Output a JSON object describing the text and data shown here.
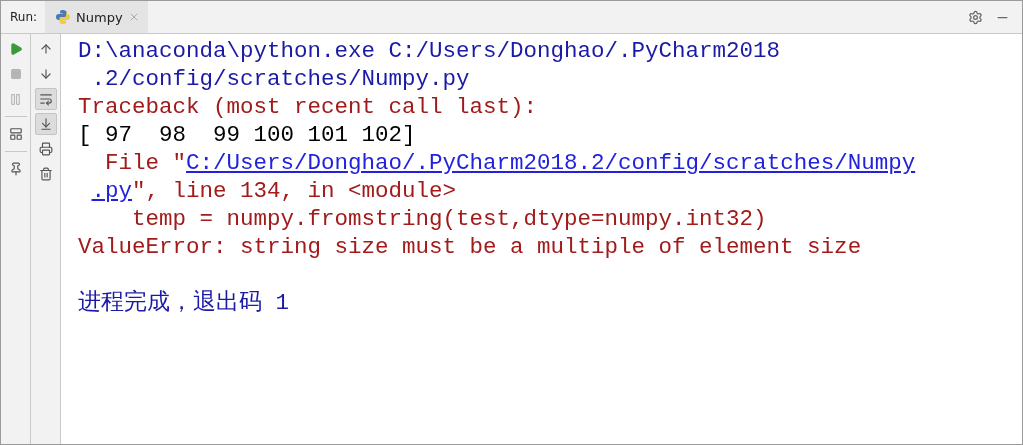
{
  "header": {
    "label": "Run:",
    "tabs": [
      {
        "label": "Numpy",
        "selected": true
      }
    ]
  },
  "left_toolbar": [
    {
      "kind": "run"
    },
    {
      "kind": "stop",
      "disabled": true
    },
    {
      "kind": "pause",
      "disabled": true
    },
    {
      "kind": "sep"
    },
    {
      "kind": "layout"
    },
    {
      "kind": "sep"
    },
    {
      "kind": "pin"
    }
  ],
  "right_toolbar": [
    {
      "kind": "up",
      "selected": false
    },
    {
      "kind": "down",
      "selected": false
    },
    {
      "kind": "wrap",
      "selected": true
    },
    {
      "kind": "scroll",
      "selected": true
    },
    {
      "kind": "print",
      "selected": false
    },
    {
      "kind": "trash",
      "selected": false
    }
  ],
  "console": {
    "lines": [
      [
        {
          "kind": "cmd",
          "text": "D:\\anaconda\\python.exe C:/Users/Donghao/.PyCharm2018"
        }
      ],
      [
        {
          "kind": "cmd",
          "text": " .2/config/scratches/Numpy.py"
        }
      ],
      [
        {
          "kind": "error",
          "text": "Traceback (most recent call last):"
        }
      ],
      [
        {
          "kind": "output",
          "text": "[ 97  98  99 100 101 102]"
        }
      ],
      [
        {
          "kind": "error",
          "text": "  File \""
        },
        {
          "kind": "link",
          "text": "C:/Users/Donghao/.PyCharm2018.2/config/scratches/Numpy"
        }
      ],
      [
        {
          "kind": "link",
          "text": ".py",
          "indented": true
        },
        {
          "kind": "error",
          "text": "\", line 134, in <module>"
        }
      ],
      [
        {
          "kind": "error",
          "text": "    temp = numpy.fromstring(test,dtype=numpy.int32)"
        }
      ],
      [
        {
          "kind": "error",
          "text": "ValueError: string size must be a multiple of element size"
        }
      ]
    ],
    "exit_message": "进程完成，退出码 1"
  }
}
